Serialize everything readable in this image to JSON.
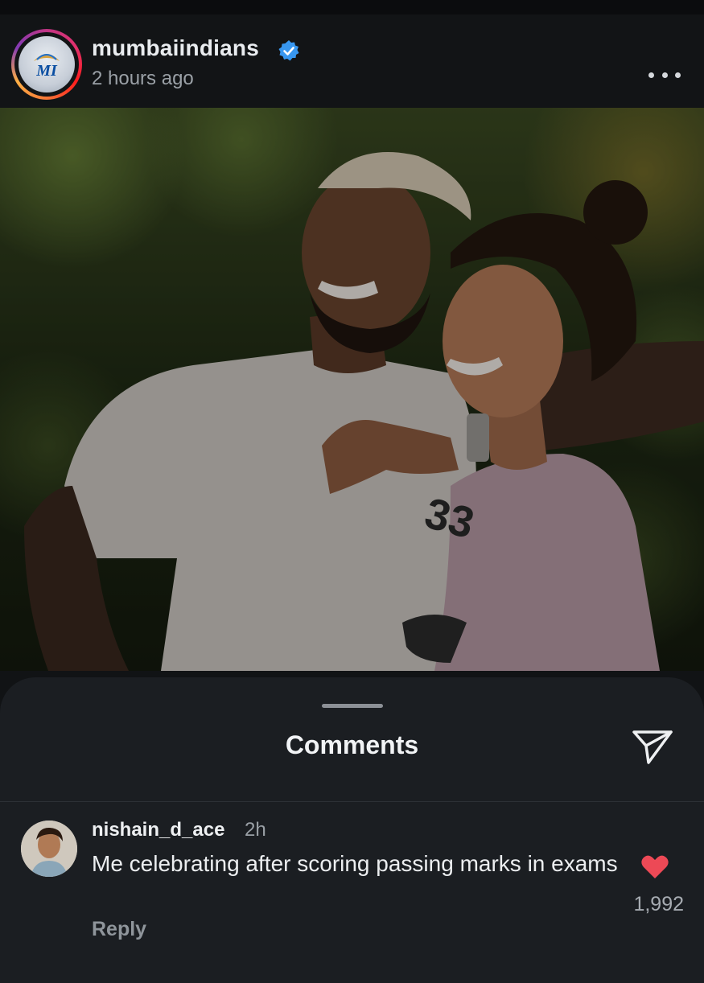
{
  "post": {
    "username": "mumbaiindians",
    "timestamp": "2 hours ago",
    "logo_text": "MI",
    "colors": {
      "verified": "#3897f0",
      "brand": "#0a4ea2"
    }
  },
  "comments_sheet": {
    "title": "Comments",
    "comment": {
      "username": "nishain_d_ace",
      "time": "2h",
      "text": "Me celebrating after scoring passing marks in exams",
      "reply_label": "Reply",
      "like_count": "1,992",
      "liked": true,
      "like_color": "#ed4956"
    },
    "icons": {
      "share": "send-icon",
      "like": "heart-icon",
      "more": "more-dots-icon",
      "verified": "verified-badge-icon"
    }
  }
}
